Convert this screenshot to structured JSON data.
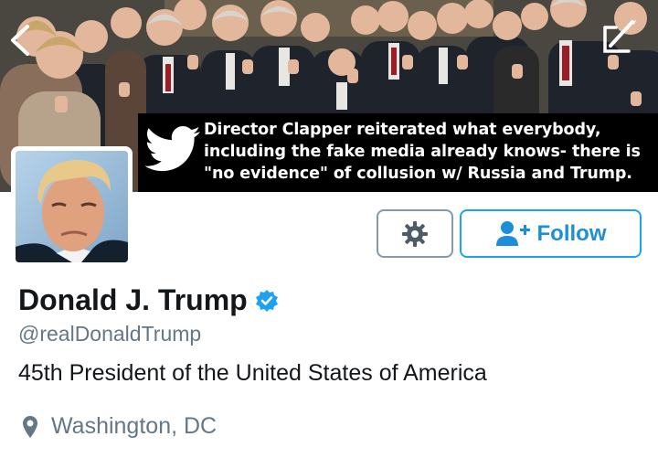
{
  "header": {
    "back_icon": "chevron-left-icon",
    "edit_icon": "edit-photo-icon"
  },
  "tweet": {
    "icon": "twitter-bird-icon",
    "lines": [
      "Director Clapper reiterated what everybody,",
      "including the fake media already knows- there is",
      "\"no evidence\" of collusion w/ Russia and Trump."
    ]
  },
  "actions": {
    "settings_icon": "gear-icon",
    "follow_icon": "add-user-icon",
    "follow_label": "Follow"
  },
  "profile": {
    "name": "Donald J. Trump",
    "verified_icon": "verified-badge-icon",
    "handle": "@realDonaldTrump",
    "bio": "45th President of the United States of America",
    "location_icon": "location-pin-icon",
    "location": "Washington, DC"
  },
  "colors": {
    "accent": "#1da1f2",
    "text": "#14171a",
    "muted": "#657786",
    "banner_overlay": "#000000"
  }
}
